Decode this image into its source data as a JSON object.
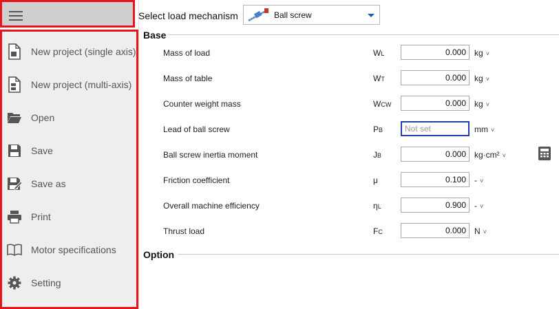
{
  "sidebar": {
    "items": [
      {
        "label": "New project (single axis)",
        "icon": "new-file-icon"
      },
      {
        "label": "New project (multi-axis)",
        "icon": "new-multi-file-icon"
      },
      {
        "label": "Open",
        "icon": "folder-open-icon"
      },
      {
        "label": "Save",
        "icon": "floppy-disk-icon"
      },
      {
        "label": "Save as",
        "icon": "save-as-icon"
      },
      {
        "label": "Print",
        "icon": "printer-icon"
      },
      {
        "label": "Motor specifications",
        "icon": "book-icon"
      },
      {
        "label": "Setting",
        "icon": "gear-icon"
      }
    ]
  },
  "header": {
    "label": "Select load mechanism",
    "mechanism": "Ball screw"
  },
  "sections": {
    "base": "Base",
    "option": "Option"
  },
  "params": [
    {
      "name": "Mass of load",
      "sym": "W",
      "sub": "L",
      "value": "0.000",
      "placeholder": "",
      "unit": "kg",
      "chev": "˅"
    },
    {
      "name": "Mass of table",
      "sym": "W",
      "sub": "T",
      "value": "0.000",
      "placeholder": "",
      "unit": "kg",
      "chev": "˅"
    },
    {
      "name": "Counter weight mass",
      "sym": "W",
      "sub": "CW",
      "value": "0.000",
      "placeholder": "",
      "unit": "kg",
      "chev": "˅"
    },
    {
      "name": "Lead of ball screw",
      "sym": "P",
      "sub": "B",
      "value": "",
      "placeholder": "Not set",
      "unit": "mm",
      "chev": "˅"
    },
    {
      "name": "Ball screw inertia moment",
      "sym": "J",
      "sub": "B",
      "value": "0.000",
      "placeholder": "",
      "unit": "kg·cm²",
      "chev": "˅"
    },
    {
      "name": "Friction coefficient",
      "sym": "μ",
      "sub": "",
      "value": "0.100",
      "placeholder": "",
      "unit": "-",
      "chev": "˅"
    },
    {
      "name": "Overall machine efficiency",
      "sym": "η",
      "sub": "L",
      "value": "0.900",
      "placeholder": "",
      "unit": "-",
      "chev": "˅"
    },
    {
      "name": "Thrust load",
      "sym": "F",
      "sub": "C",
      "value": "0.000",
      "placeholder": "",
      "unit": "N",
      "chev": "˅"
    }
  ],
  "colors": {
    "highlight_border": "#e4161c",
    "sidebar_bg": "#eeeeee",
    "accent": "#1a5fb4"
  }
}
